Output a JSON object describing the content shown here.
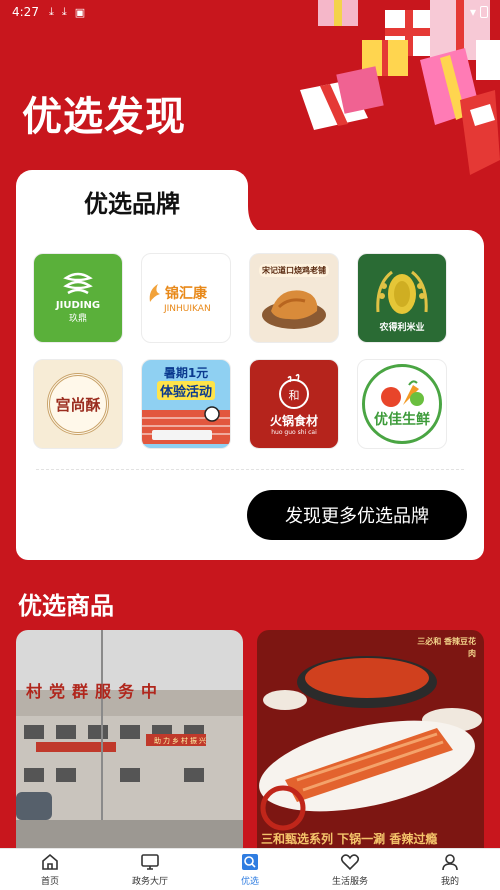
{
  "status_bar": {
    "time": "4:27"
  },
  "page": {
    "title": "优选发现"
  },
  "brands": {
    "section_title": "优选品牌",
    "items": [
      {
        "name": "JIUDING",
        "subtitle": "玖鼎",
        "icon": "jiuding-logo"
      },
      {
        "name": "锦汇康",
        "subtitle": "JINHUIKAN",
        "icon": "jinhuikang-logo"
      },
      {
        "name": "宋记道口烧鸡老铺",
        "subtitle": "",
        "icon": "roast-chicken-logo"
      },
      {
        "name": "农得利米业",
        "subtitle": "",
        "icon": "rice-grain-logo"
      },
      {
        "name": "宫尚酥",
        "subtitle": "",
        "icon": "gongshangsu-logo"
      },
      {
        "name": "暑期1元",
        "subtitle": "体验活动",
        "icon": "summer-activity-banner"
      },
      {
        "name": "火锅食材",
        "subtitle": "huo guo shi cai",
        "icon": "hotpot-logo"
      },
      {
        "name": "优佳生鲜",
        "subtitle": "",
        "icon": "youjia-fresh-logo"
      }
    ],
    "more_button": "发现更多优选品牌"
  },
  "goods": {
    "section_title": "优选商品",
    "cards": [
      {
        "caption": "村党群服务中",
        "banner": "助力乡村振兴"
      },
      {
        "caption": "三和甄选系列 下锅一涮 香辣过瘾",
        "badge": "三必和 香辣豆花肉"
      }
    ]
  },
  "tabbar": {
    "items": [
      {
        "label": "首页",
        "icon": "home-icon"
      },
      {
        "label": "政务大厅",
        "icon": "monitor-icon"
      },
      {
        "label": "优选",
        "icon": "discover-icon",
        "active": true
      },
      {
        "label": "生活服务",
        "icon": "heart-icon"
      },
      {
        "label": "我的",
        "icon": "user-icon"
      }
    ]
  },
  "colors": {
    "primary_red": "#c8161d",
    "accent_blue": "#2f7de1",
    "black": "#000000"
  }
}
